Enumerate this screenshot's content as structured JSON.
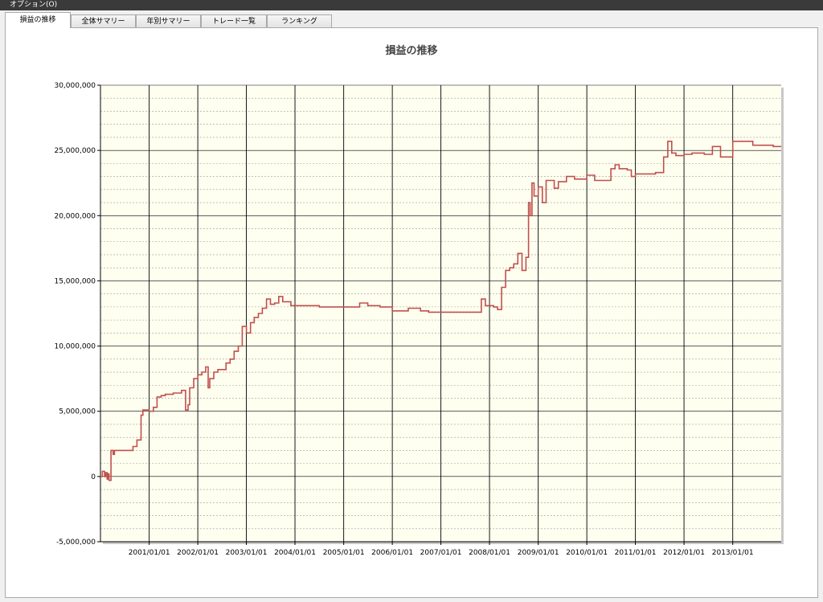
{
  "menu": {
    "options": "オプション(O)"
  },
  "tabs": [
    {
      "label": "損益の推移",
      "active": true
    },
    {
      "label": "全体サマリー",
      "active": false
    },
    {
      "label": "年別サマリー",
      "active": false
    },
    {
      "label": "トレード一覧",
      "active": false
    },
    {
      "label": "ランキング",
      "active": false
    }
  ],
  "colors": {
    "plot_background": "#fffff0",
    "series_line": "#c0504d",
    "major_grid": "#000000",
    "minor_grid": "#9a9a9a"
  },
  "chart_data": {
    "type": "line",
    "title": "損益の推移",
    "xlabel": "",
    "ylabel": "",
    "x_range": [
      "2000/01/01",
      "2013/12/31"
    ],
    "ylim": [
      -5000000,
      30000000
    ],
    "y_ticks": [
      -5000000,
      0,
      5000000,
      10000000,
      15000000,
      20000000,
      25000000,
      30000000
    ],
    "y_tick_labels": [
      "-5,000,000",
      "0",
      "5,000,000",
      "10,000,000",
      "15,000,000",
      "20,000,000",
      "25,000,000",
      "30,000,000"
    ],
    "x_tick_labels": [
      "2001/01/01",
      "2002/01/01",
      "2003/01/01",
      "2004/01/01",
      "2005/01/01",
      "2006/01/01",
      "2007/01/01",
      "2008/01/01",
      "2009/01/01",
      "2010/01/01",
      "2011/01/01",
      "2012/01/01",
      "2013/01/01"
    ],
    "grid": true,
    "series": [
      {
        "step": true,
        "points": [
          [
            "2000/01/01",
            0
          ],
          [
            "2000/01/15",
            400000
          ],
          [
            "2000/02/01",
            0
          ],
          [
            "2000/02/10",
            300000
          ],
          [
            "2000/02/20",
            -200000
          ],
          [
            "2000/03/01",
            200000
          ],
          [
            "2000/03/05",
            -300000
          ],
          [
            "2000/03/20",
            2000000
          ],
          [
            "2000/04/05",
            1700000
          ],
          [
            "2000/04/15",
            2000000
          ],
          [
            "2000/08/01",
            2000000
          ],
          [
            "2000/09/01",
            2300000
          ],
          [
            "2000/10/01",
            2800000
          ],
          [
            "2000/11/01",
            4700000
          ],
          [
            "2000/11/15",
            5100000
          ],
          [
            "2001/01/01",
            5000000
          ],
          [
            "2001/02/01",
            5300000
          ],
          [
            "2001/03/01",
            6100000
          ],
          [
            "2001/04/01",
            6200000
          ],
          [
            "2001/05/01",
            6300000
          ],
          [
            "2001/07/01",
            6400000
          ],
          [
            "2001/09/01",
            6600000
          ],
          [
            "2001/10/01",
            5100000
          ],
          [
            "2001/10/20",
            5500000
          ],
          [
            "2001/11/01",
            6800000
          ],
          [
            "2001/12/01",
            7500000
          ],
          [
            "2002/01/01",
            7800000
          ],
          [
            "2002/02/01",
            8000000
          ],
          [
            "2002/03/01",
            8400000
          ],
          [
            "2002/03/20",
            6800000
          ],
          [
            "2002/04/01",
            7500000
          ],
          [
            "2002/05/01",
            8000000
          ],
          [
            "2002/06/01",
            8200000
          ],
          [
            "2002/08/01",
            8700000
          ],
          [
            "2002/09/01",
            9000000
          ],
          [
            "2002/10/01",
            9600000
          ],
          [
            "2002/11/01",
            10000000
          ],
          [
            "2002/12/01",
            11500000
          ],
          [
            "2003/01/01",
            11000000
          ],
          [
            "2003/02/01",
            11800000
          ],
          [
            "2003/03/01",
            12200000
          ],
          [
            "2003/04/01",
            12500000
          ],
          [
            "2003/05/01",
            12900000
          ],
          [
            "2003/06/01",
            13600000
          ],
          [
            "2003/07/01",
            13200000
          ],
          [
            "2003/08/01",
            13300000
          ],
          [
            "2003/09/01",
            13800000
          ],
          [
            "2003/10/01",
            13400000
          ],
          [
            "2003/12/01",
            13100000
          ],
          [
            "2004/06/01",
            13100000
          ],
          [
            "2004/07/01",
            13000000
          ],
          [
            "2005/04/01",
            13000000
          ],
          [
            "2005/05/01",
            13300000
          ],
          [
            "2005/07/01",
            13100000
          ],
          [
            "2005/10/01",
            13000000
          ],
          [
            "2006/01/01",
            12700000
          ],
          [
            "2006/05/01",
            12900000
          ],
          [
            "2006/08/01",
            12700000
          ],
          [
            "2006/10/01",
            12600000
          ],
          [
            "2007/10/01",
            12600000
          ],
          [
            "2007/11/01",
            13600000
          ],
          [
            "2007/12/01",
            13100000
          ],
          [
            "2008/02/01",
            13000000
          ],
          [
            "2008/03/01",
            12800000
          ],
          [
            "2008/04/01",
            14500000
          ],
          [
            "2008/05/01",
            15800000
          ],
          [
            "2008/06/01",
            16000000
          ],
          [
            "2008/07/01",
            16300000
          ],
          [
            "2008/08/01",
            17100000
          ],
          [
            "2008/09/01",
            15800000
          ],
          [
            "2008/10/01",
            16800000
          ],
          [
            "2008/10/20",
            21000000
          ],
          [
            "2008/11/01",
            20000000
          ],
          [
            "2008/11/15",
            22500000
          ],
          [
            "2008/12/01",
            21500000
          ],
          [
            "2009/01/01",
            22200000
          ],
          [
            "2009/02/01",
            21000000
          ],
          [
            "2009/03/01",
            22700000
          ],
          [
            "2009/05/01",
            22100000
          ],
          [
            "2009/06/01",
            22600000
          ],
          [
            "2009/08/01",
            23000000
          ],
          [
            "2009/10/01",
            22800000
          ],
          [
            "2010/01/01",
            23100000
          ],
          [
            "2010/03/01",
            22700000
          ],
          [
            "2010/07/01",
            23600000
          ],
          [
            "2010/08/01",
            23900000
          ],
          [
            "2010/09/01",
            23600000
          ],
          [
            "2010/11/01",
            23500000
          ],
          [
            "2010/12/01",
            23000000
          ],
          [
            "2011/01/01",
            23200000
          ],
          [
            "2011/06/01",
            23300000
          ],
          [
            "2011/08/01",
            24500000
          ],
          [
            "2011/09/01",
            25700000
          ],
          [
            "2011/10/01",
            24800000
          ],
          [
            "2011/11/01",
            24600000
          ],
          [
            "2012/01/01",
            24700000
          ],
          [
            "2012/03/01",
            24800000
          ],
          [
            "2012/06/01",
            24700000
          ],
          [
            "2012/08/01",
            25300000
          ],
          [
            "2012/10/01",
            24500000
          ],
          [
            "2013/01/01",
            25700000
          ],
          [
            "2013/06/01",
            25400000
          ],
          [
            "2013/11/01",
            25300000
          ],
          [
            "2013/12/31",
            25300000
          ]
        ]
      }
    ]
  }
}
